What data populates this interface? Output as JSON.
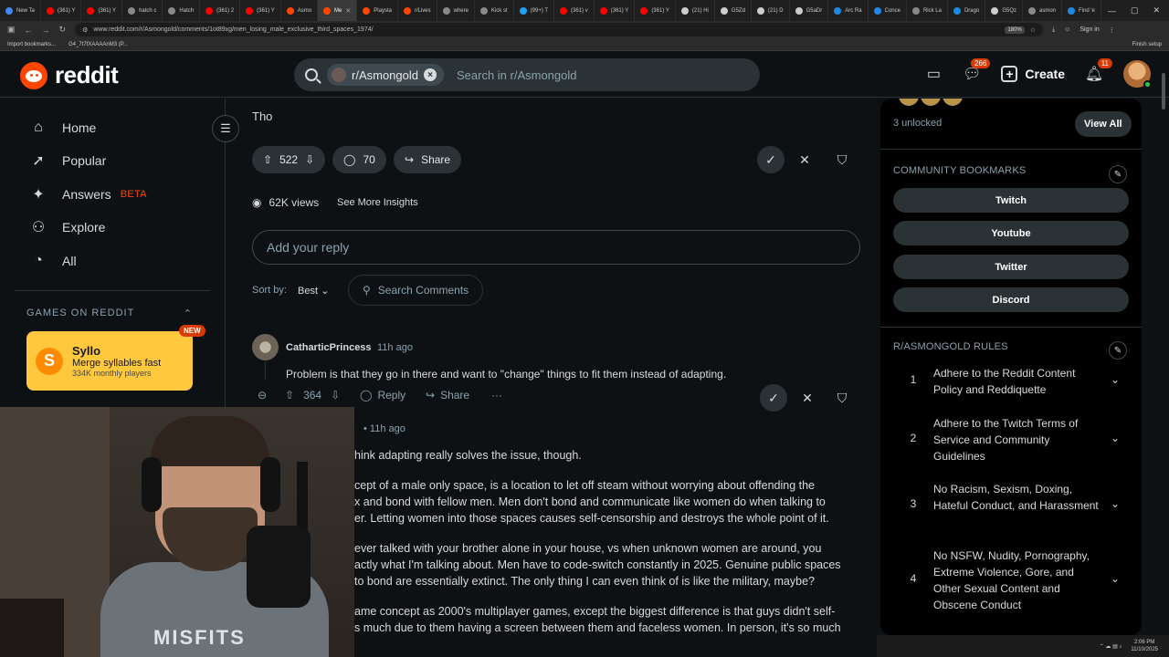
{
  "browser": {
    "tabs": [
      {
        "label": "New Ta",
        "color": "#4285f4"
      },
      {
        "label": "(361) Y",
        "color": "#ff0000"
      },
      {
        "label": "(361) Y",
        "color": "#ff0000"
      },
      {
        "label": "hatch c",
        "color": "#888888"
      },
      {
        "label": "Hatch",
        "color": "#888888"
      },
      {
        "label": "(361) 2",
        "color": "#ff0000"
      },
      {
        "label": "(361) Y",
        "color": "#ff0000"
      },
      {
        "label": "Asmo",
        "color": "#ff4500"
      },
      {
        "label": "Me",
        "color": "#ff4500",
        "active": true
      },
      {
        "label": "Playsta",
        "color": "#ff4500"
      },
      {
        "label": "r/Lives",
        "color": "#ff4500"
      },
      {
        "label": "where",
        "color": "#888888"
      },
      {
        "label": "Kick st",
        "color": "#888888"
      },
      {
        "label": "(99+) T",
        "color": "#1da1f2"
      },
      {
        "label": "(361) v",
        "color": "#ff0000"
      },
      {
        "label": "(361) Y",
        "color": "#ff0000"
      },
      {
        "label": "(361) Y",
        "color": "#ff0000"
      },
      {
        "label": "(21) Hi",
        "color": "#cccccc"
      },
      {
        "label": "G5Zd",
        "color": "#cccccc"
      },
      {
        "label": "(21) D",
        "color": "#cccccc"
      },
      {
        "label": "G5aDr",
        "color": "#cccccc"
      },
      {
        "label": "Arc Ra",
        "color": "#1e88e5"
      },
      {
        "label": "Conce",
        "color": "#1e88e5"
      },
      {
        "label": "Rick La",
        "color": "#888888"
      },
      {
        "label": "Drago",
        "color": "#1e88e5"
      },
      {
        "label": "G5Qz",
        "color": "#cccccc"
      },
      {
        "label": "asmon",
        "color": "#888888"
      },
      {
        "label": "Find 'e",
        "color": "#1e88e5"
      }
    ],
    "url": "www.reddit.com/r/Asmongold/comments/1ot89xg/men_losing_male_exclusive_third_spaces_1974/",
    "zoom": "180%",
    "signin": "Sign in",
    "bookmarks": [
      "Import bookmarks...",
      "G4_7t7fXAAAAnM3 (P..."
    ],
    "finish_setup": "Finish setup"
  },
  "header": {
    "logo_text": "reddit",
    "community_chip": "r/Asmongold",
    "search_placeholder": "Search in r/Asmongold",
    "chat_badge": "266",
    "create_label": "Create",
    "notif_badge": "11"
  },
  "left_nav": {
    "items": [
      {
        "label": "Home",
        "icon": "home-icon"
      },
      {
        "label": "Popular",
        "icon": "popular-icon"
      },
      {
        "label": "Answers",
        "icon": "answers-icon",
        "badge": "BETA"
      },
      {
        "label": "Explore",
        "icon": "explore-icon"
      },
      {
        "label": "All",
        "icon": "all-icon"
      }
    ],
    "games_header": "GAMES ON REDDIT",
    "game": {
      "title": "Syllo",
      "subtitle": "Merge syllables fast",
      "players": "334K monthly players",
      "badge": "NEW"
    }
  },
  "post": {
    "text": "Tho",
    "votes": "522",
    "comments": "70",
    "share_label": "Share",
    "views": "62K views",
    "insights_label": "See More Insights",
    "reply_placeholder": "Add your reply",
    "sort_label": "Sort by:",
    "sort_value": "Best",
    "search_comments": "Search Comments"
  },
  "comments": [
    {
      "user": "CatharticPrincess",
      "time": "11h ago",
      "body": "Problem is that they go in there and want to \"change\" things to fit them instead of adapting.",
      "votes": "364",
      "reply_label": "Reply",
      "share_label": "Share"
    },
    {
      "time": "• 11h ago",
      "lines": [
        "hink adapting really solves the issue, though.",
        "cept of a male only space, is a location to let off steam without worrying about offending the",
        "x and bond with fellow men. Men don't bond and communicate like women do when talking to",
        "er. Letting women into those spaces causes self-censorship and destroys the whole point of it.",
        "ever talked with your brother alone in your house, vs when unknown women are around, you",
        "actly what I'm talking about. Men have to code-switch constantly in 2025. Genuine public spaces",
        "to bond are essentially extinct. The only thing I can even think of is like the military, maybe?",
        "ame concept as 2000's multiplayer games, except the biggest difference is that guys didn't self-",
        "s much due to them having a screen between them and faceless women. In person, it's so much"
      ]
    }
  ],
  "right_sidebar": {
    "unlocked": "3 unlocked",
    "view_all": "View All",
    "bookmarks_header": "COMMUNITY BOOKMARKS",
    "bookmarks": [
      "Twitch",
      "Youtube",
      "Twitter",
      "Discord"
    ],
    "rules_header": "R/ASMONGOLD RULES",
    "rules": [
      {
        "n": "1",
        "text": "Adhere to the Reddit Content Policy and Reddiquette"
      },
      {
        "n": "2",
        "text": "Adhere to the Twitch Terms of Service and Community Guidelines"
      },
      {
        "n": "3",
        "text": "No Racism, Sexism, Doxing, Hateful Conduct, and Harassment"
      },
      {
        "n": "4",
        "text": "No NSFW, Nudity, Pornography, Extreme Violence, Gore, and Other Sexual Content and Obscene Conduct"
      }
    ]
  },
  "webcam": {
    "shirt_text": "MISFITS"
  },
  "taskbar": {
    "time": "2:06 PM",
    "date": "11/10/2025"
  }
}
